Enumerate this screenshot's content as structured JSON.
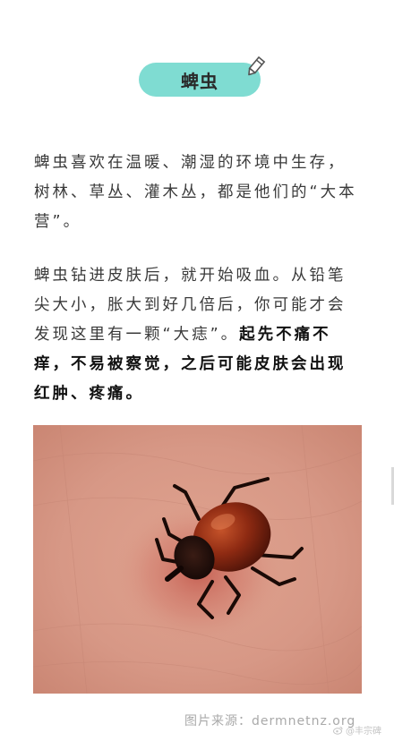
{
  "section": {
    "title": "蜱虫",
    "pencil_icon": "pencil-icon"
  },
  "paragraph1": {
    "text": "蜱虫喜欢在温暖、潮湿的环境中生存，树林、草丛、灌木丛，都是他们的“大本营”。"
  },
  "paragraph2": {
    "normal": "蜱虫钻进皮肤后，就开始吸血。从铅笔尖大小，胀大到好几倍后，你可能才会发现这里有一颗“大痣”。",
    "bold": "起先不痛不痒，不易被察觉，之后可能皮肤会出现红肿、疼痛。"
  },
  "image": {
    "subject": "tick-on-skin-photo"
  },
  "caption": {
    "text": "图片来源：dermnetnz.org"
  },
  "watermark": {
    "text": "@丰宗碑",
    "icon": "weibo-icon"
  },
  "colors": {
    "pill": "#7fdcd2",
    "text": "#3a3a3a",
    "caption": "#a9a9a9"
  }
}
